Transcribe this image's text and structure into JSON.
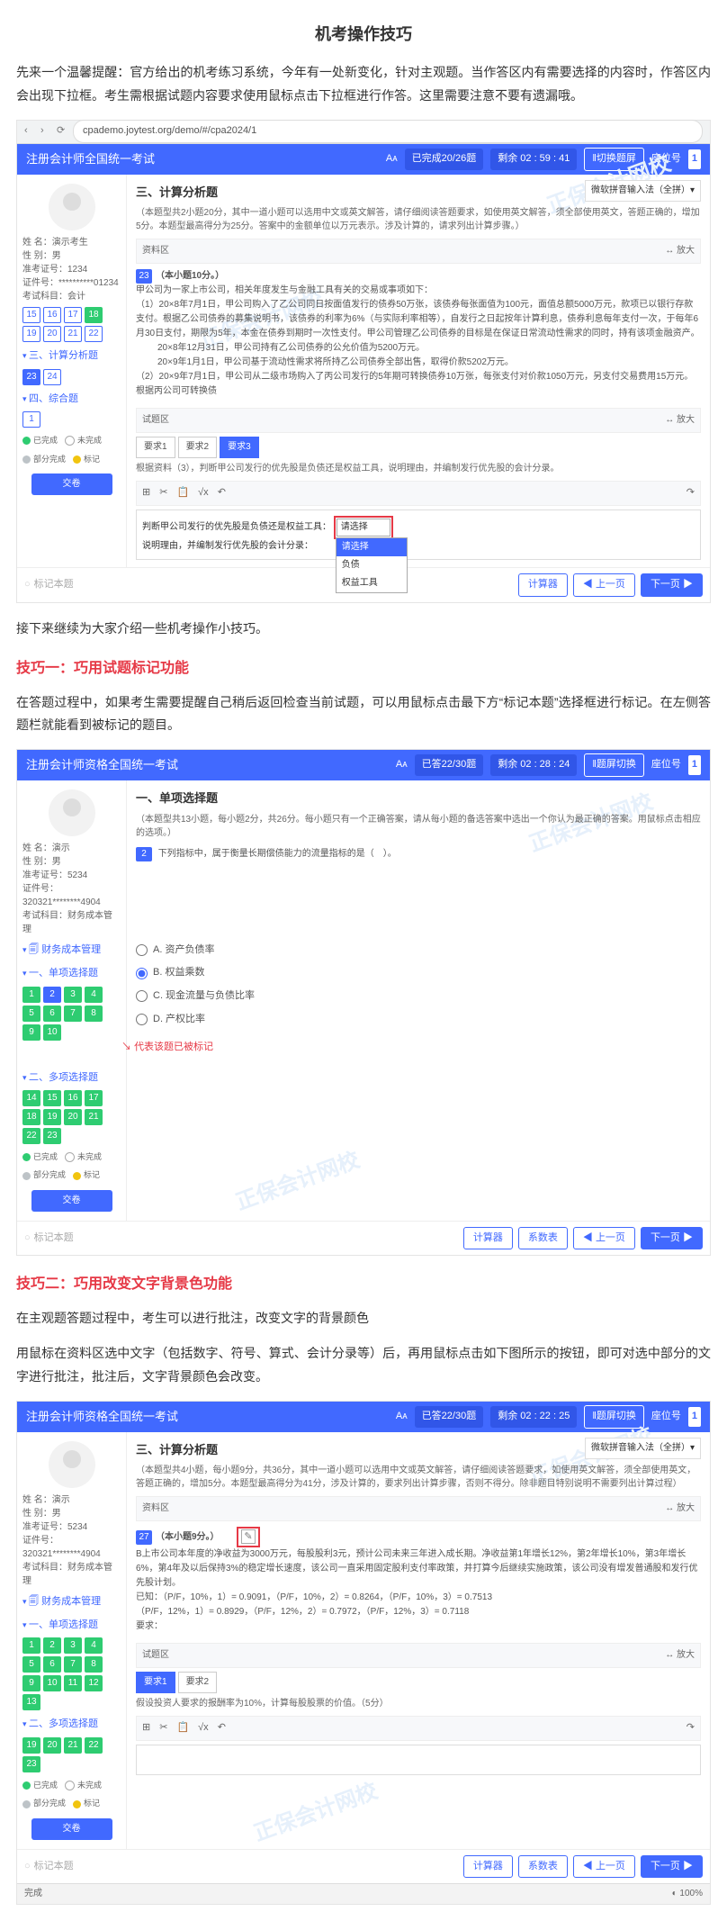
{
  "article": {
    "main_title": "机考操作技巧",
    "intro": "先来一个温馨提醒：官方给出的机考练习系统，今年有一处新变化，针对主观题。当作答区内有需要选择的内容时，作答区内会出现下拉框。考生需根据试题内容要求使用鼠标点击下拉框进行作答。这里需要注意不要有遗漏哦。",
    "bridge": "接下来继续为大家介绍一些机考操作小技巧。",
    "tip1_title": "技巧一：巧用试题标记功能",
    "tip1_body": "在答题过程中，如果考生需要提醒自己稍后返回检查当前试题，可以用鼠标点击最下方“标记本题”选择框进行标记。在左侧答题栏就能看到被标记的题目。",
    "tip2_title": "技巧二：巧用改变文字背景色功能",
    "tip2_body1": "在主观题答题过程中，考生可以进行批注，改变文字的背景颜色",
    "tip2_body2": "用鼠标在资料区选中文字（包括数字、符号、算式、会计分录等）后，再用鼠标点击如下图所示的按钮，即可对选中部分的文字进行批注，批注后，文字背景颜色会改变。"
  },
  "s1": {
    "url": "cpademo.joytest.org/demo/#/cpa2024/1",
    "exam_title": "注册会计师全国统一考试",
    "done": "已完成20/26题",
    "time": "剩余  02 : 59 : 41",
    "resize": "‖切换题屏",
    "seat_label": "座位号",
    "seat_no": "1",
    "ime": "微软拼音输入法（全拼）▾",
    "candidate": {
      "name": "姓  名：演示考生",
      "sex": "性  别：男",
      "id": "准考证号：1234",
      "idno": "证件号：**********01234",
      "subj": "考试科目：会计"
    },
    "nums_plain": [
      "15",
      "16",
      "17",
      "18",
      "19",
      "20",
      "21",
      "22"
    ],
    "sec_calc": "三、计算分析题",
    "calc_nums": [
      "23",
      "24"
    ],
    "sec_comp": "四、综合题",
    "comp_nums": [
      "1"
    ],
    "legend": {
      "done": "已完成",
      "no": "未完成",
      "half": "部分完成",
      "mark": "标记"
    },
    "submit": "交卷",
    "q_title": "三、计算分析题",
    "q_sub": "（本题型共2小题20分，其中一道小题可以选用中文或英文解答，请仔细阅读答题要求，如使用英文解答，须全部使用英文，答题正确的，增加5分。本题型最高得分为25分。答案中的金额单位以万元表示。涉及计算的，请求列出计算步骤。）",
    "zone_material_lbl": "资料区",
    "expand": "↔ 放大",
    "q_num": "23",
    "q_num_txt": "（本小题10分。）",
    "mat1": "甲公司为一家上市公司，相关年度发生与金融工具有关的交易或事项如下：",
    "mat2": "（1）20×8年7月1日，甲公司购入了乙公司同日按面值发行的债券50万张，该债券每张面值为100元，面值总额5000万元，款项已以银行存款支付。根据乙公司债券的募集说明书，该债券的利率为6%（与实际利率相等），自发行之日起按年计算利息，债券利息每年支付一次，于每年6月30日支付，期限为5年，本金在债券到期时一次性支付。甲公司管理乙公司债券的目标是在保证日常流动性需求的同时，持有该项金融资产。",
    "mat3": "20×8年12月31日，甲公司持有乙公司债券的公允价值为5200万元。",
    "mat4": "20×9年1月1日，甲公司基于流动性需求将所持乙公司债券全部出售，取得价款5202万元。",
    "mat5": "（2）20×9年7月1日，甲公司从二级市场购入了丙公司发行的5年期可转换债券10万张，每张支付对价款1050万元，另支付交易费用15万元。根据丙公司可转换债",
    "zone_ans_lbl": "试题区",
    "tabs": [
      "要求1",
      "要求2",
      "要求3"
    ],
    "req_text": "根据资料（3），判断甲公司发行的优先股是负债还是权益工具，说明理由，并编制发行优先股的会计分录。",
    "ans_prefix": "判断甲公司发行的优先股是负债还是权益工具：",
    "dd_placeholder": "请选择",
    "dd_opts": [
      "请选择",
      "负债",
      "权益工具"
    ],
    "ans_suffix": "说明理由，并编制发行优先股的会计分录：",
    "mark_label": "标记本题",
    "calc_btn": "计算器",
    "prev": "上一页",
    "next": "下一页"
  },
  "s2": {
    "exam_title": "注册会计师资格全国统一考试",
    "done": "已答22/30题",
    "time": "剩余  02 : 28 : 24",
    "resize": "‖题屏切换",
    "seat_label": "座位号",
    "seat_no": "1",
    "candidate": {
      "name": "姓  名：演示",
      "sex": "性  别：男",
      "id": "准考证号：5234",
      "idno": "证件号：320321********4904",
      "subj": "考试科目：财务成本管理"
    },
    "nav_subject": "财务成本管理",
    "sec_single": "一、单项选择题",
    "single_nums": [
      "1",
      "2",
      "3",
      "4",
      "5",
      "6",
      "7",
      "8",
      "9",
      "10"
    ],
    "sec_multi": "二、多项选择题",
    "multi_nums": [
      "14",
      "15",
      "16",
      "17",
      "18",
      "19",
      "20",
      "21",
      "22",
      "23"
    ],
    "legend": {
      "done": "已完成",
      "no": "未完成",
      "half": "部分完成",
      "mark": "标记"
    },
    "submit": "交卷",
    "q_title": "一、单项选择题",
    "q_sub": "（本题型共13小题，每小题2分，共26分。每小题只有一个正确答案，请从每小题的备选答案中选出一个你认为最正确的答案。用鼠标点击相应的选项。）",
    "q_num": "2",
    "q_text": "下列指标中，属于衡量长期偿债能力的流量指标的是（　）。",
    "arrow_note": "代表该题已被标记",
    "opts": [
      "A.  资产负债率",
      "B.  权益乘数",
      "C.  现金流量与负债比率",
      "D.  产权比率"
    ],
    "mark_label": "标记本题",
    "calc_btn": "计算器",
    "coef_btn": "系数表",
    "prev": "上一页",
    "next": "下一页"
  },
  "s3": {
    "exam_title": "注册会计师资格全国统一考试",
    "done": "已答22/30题",
    "time": "剩余  02 : 22 : 25",
    "resize": "‖题屏切换",
    "seat_label": "座位号",
    "seat_no": "1",
    "ime": "微软拼音输入法（全拼）▾",
    "candidate": {
      "name": "姓  名：演示",
      "sex": "性  别：男",
      "id": "准考证号：5234",
      "idno": "证件号：320321********4904",
      "subj": "考试科目：财务成本管理"
    },
    "nav_subject": "财务成本管理",
    "sec_single": "一、单项选择题",
    "single_nums": [
      "1",
      "2",
      "3",
      "4",
      "5",
      "6",
      "7",
      "8",
      "9",
      "10",
      "11",
      "12",
      "13"
    ],
    "sec_multi": "二、多项选择题",
    "multi_nums": [
      "19",
      "20",
      "21",
      "22",
      "23"
    ],
    "legend": {
      "done": "已完成",
      "no": "未完成",
      "half": "部分完成",
      "mark": "标记"
    },
    "submit": "交卷",
    "q_title": "三、计算分析题",
    "q_sub": "（本题型共4小题，每小题9分，共36分，其中一道小题可以选用中文或英文解答，请仔细阅读答题要求，如使用英文解答，须全部使用英文，答题正确的，增加5分。本题型最高得分为41分，涉及计算的，要求列出计算步骤，否则不得分。除非题目特别说明不需要列出计算过程）",
    "zone_material_lbl": "资料区",
    "expand": "↔ 放大",
    "q_num": "27",
    "q_num_txt": "（本小题9分。）",
    "mat1": "B上市公司本年度的净收益为3000万元，每股股利3元，预计公司未来三年进入成长期。净收益第1年增长12%，第2年增长10%，第3年增长6%，第4年及以后保持3%的稳定增长速度，该公司一直采用固定股利支付率政策，并打算今后继续实施政策，该公司没有增发普通股和发行优先股计划。",
    "mat2": "已知：（P/F，10%，1）= 0.9091，（P/F，10%，2）= 0.8264，（P/F，10%，3）= 0.7513",
    "mat3": "（P/F，12%，1）= 0.8929，（P/F，12%，2）= 0.7972，（P/F，12%，3）= 0.7118",
    "mat_req": "要求：",
    "zone_ans_lbl": "试题区",
    "tabs": [
      "要求1",
      "要求2"
    ],
    "req_text": "假设投资人要求的报酬率为10%，计算每股股票的价值。（5分）",
    "mark_label": "标记本题",
    "calc_btn": "计算器",
    "coef_btn": "系数表",
    "prev": "上一页",
    "next": "下一页",
    "status_bar": {
      "left": "完成",
      "right": "◐ 100%"
    }
  }
}
